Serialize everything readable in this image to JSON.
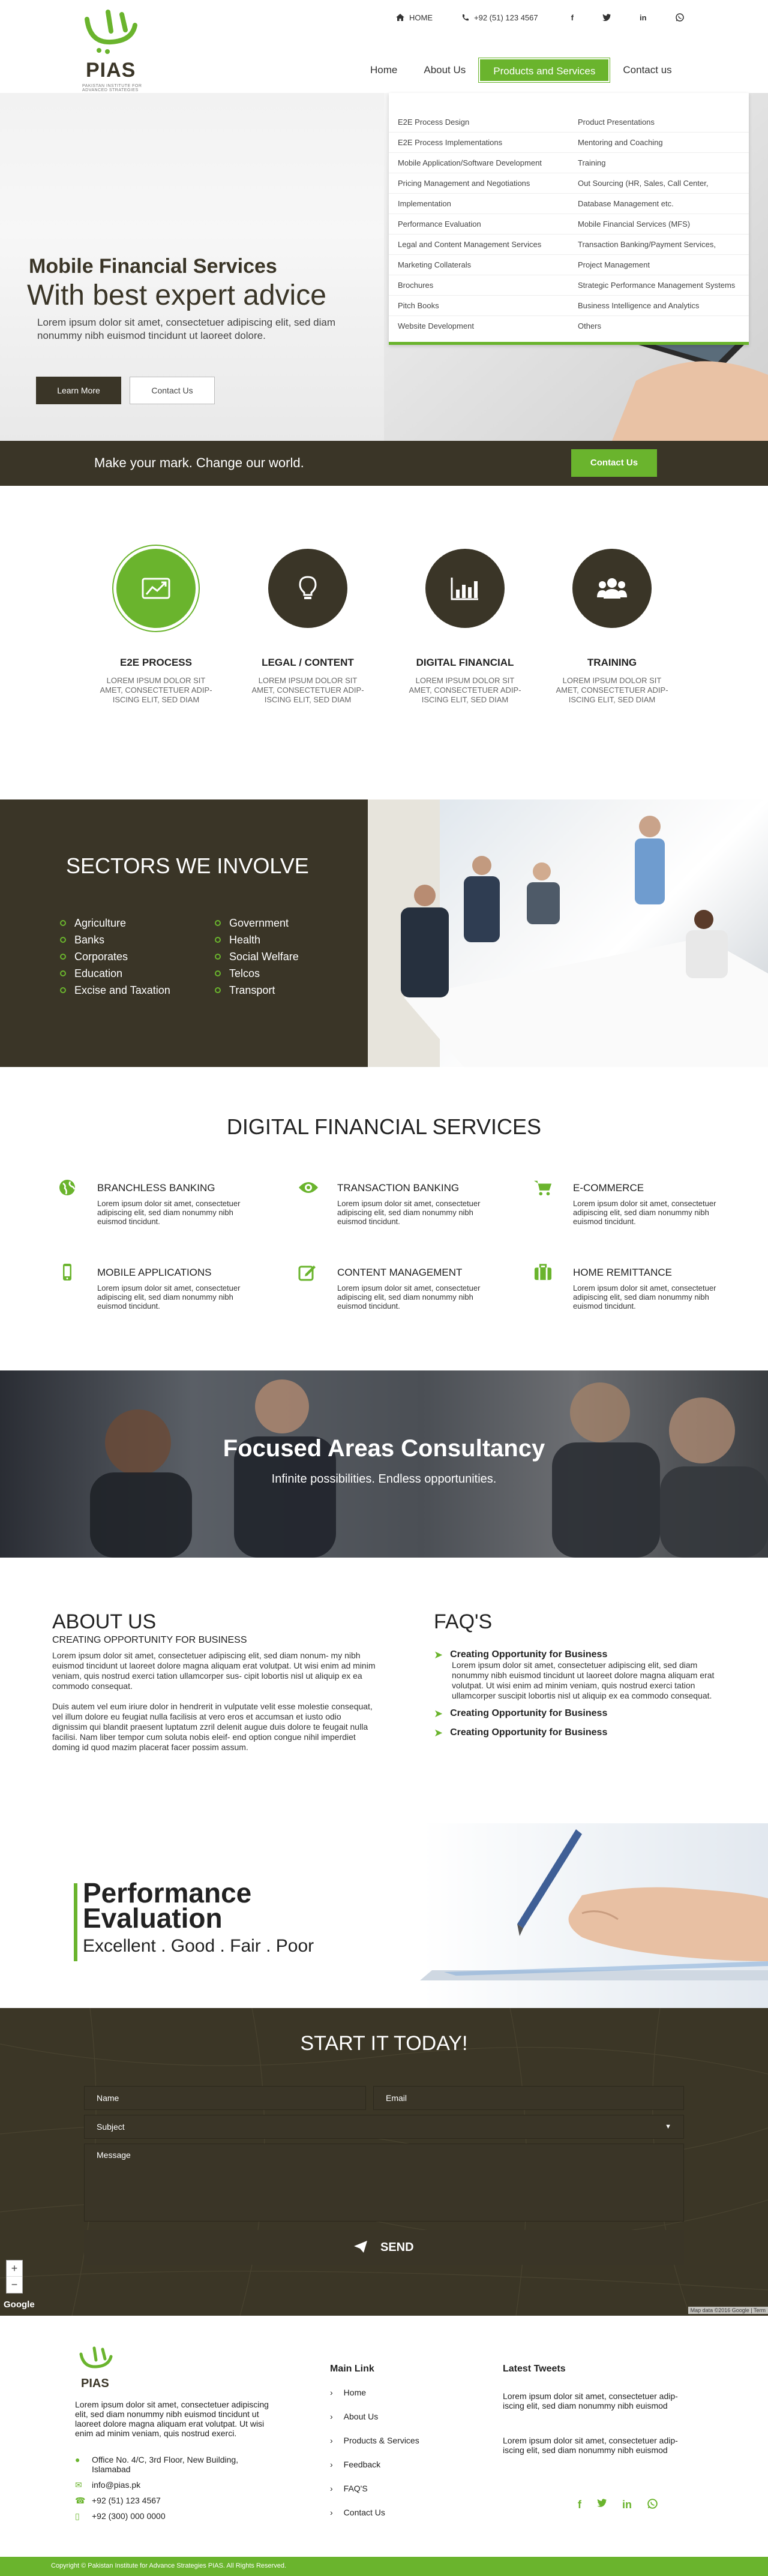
{
  "brand": {
    "name": "PIAS",
    "tagline": "PAKISTAN INSTITUTE FOR ADVANCED STRATEGIES",
    "accent": "#6ab42d",
    "dark": "#3a3527"
  },
  "topbar": {
    "home": "HOME",
    "phone": "+92 (51) 123 4567",
    "social": [
      "facebook-icon",
      "twitter-icon",
      "linkedin-icon",
      "whatsapp-icon"
    ]
  },
  "nav": {
    "items": [
      {
        "label": "Home"
      },
      {
        "label": "About Us"
      },
      {
        "label": "Products and Services"
      },
      {
        "label": "Contact us"
      }
    ]
  },
  "dropdown": {
    "col1": [
      "E2E Process Design",
      "E2E Process Implementations",
      "Mobile Application/Software Development",
      "Pricing Management and Negotiations",
      "Implementation",
      "Performance Evaluation",
      "Legal and Content Management Services",
      "Marketing Collaterals",
      "Brochures",
      "Pitch Books",
      "Website Development"
    ],
    "col2": [
      "Product Presentations",
      "Mentoring and Coaching",
      "Training",
      "Out Sourcing (HR, Sales, Call Center,",
      "Database Management etc.",
      "Mobile Financial Services (MFS)",
      "Transaction Banking/Payment Services,",
      "Project Management",
      "Strategic Performance Management Systems",
      "Business Intelligence and Analytics",
      "Others"
    ]
  },
  "hero": {
    "subtitle": "Mobile Financial Services",
    "title": "With best expert advice",
    "text": "Lorem ipsum dolor sit amet, consectetuer adipiscing elit, sed diam nonummy nibh euismod tincidunt ut laoreet dolore.",
    "btn_primary": "Learn More",
    "btn_secondary": "Contact Us"
  },
  "markbar": {
    "text": "Make your mark. Change our world.",
    "button": "Contact Us"
  },
  "features": [
    {
      "title": "E2E PROCESS",
      "text": "LOREM IPSUM DOLOR SIT AMET, CONSECTETUER ADIP- ISCING ELIT, SED DIAM",
      "icon": "chart-trend-icon"
    },
    {
      "title": "LEGAL / CONTENT",
      "text": "LOREM IPSUM DOLOR SIT AMET, CONSECTETUER ADIP- ISCING ELIT, SED DIAM",
      "icon": "lightbulb-icon"
    },
    {
      "title": "DIGITAL FINANCIAL",
      "text": "LOREM IPSUM DOLOR SIT AMET, CONSECTETUER ADIP- ISCING ELIT, SED DIAM",
      "icon": "bar-chart-icon"
    },
    {
      "title": "TRAINING",
      "text": "LOREM IPSUM DOLOR SIT AMET, CONSECTETUER ADIP- ISCING ELIT, SED DIAM",
      "icon": "users-icon"
    }
  ],
  "sectors": {
    "title": "SECTORS WE INVOLVE",
    "col1": [
      "Agriculture",
      "Banks",
      "Corporates",
      "Education",
      "Excise and Taxation"
    ],
    "col2": [
      "Government",
      "Health",
      "Social Welfare",
      "Telcos",
      "Transport"
    ]
  },
  "dfs": {
    "title": "DIGITAL FINANCIAL SERVICES",
    "items": [
      {
        "title": "BRANCHLESS BANKING",
        "text": "Lorem ipsum dolor sit amet, consectetuer adipiscing elit, sed diam nonummy nibh euismod tincidunt.",
        "icon": "globe-icon"
      },
      {
        "title": "TRANSACTION BANKING",
        "text": "Lorem ipsum dolor sit amet, consectetuer adipiscing elit, sed diam nonummy nibh euismod tincidunt.",
        "icon": "eye-icon"
      },
      {
        "title": "E-COMMERCE",
        "text": "Lorem ipsum dolor sit amet, consectetuer adipiscing elit, sed diam nonummy nibh euismod tincidunt.",
        "icon": "cart-icon"
      },
      {
        "title": "MOBILE APPLICATIONS",
        "text": "Lorem ipsum dolor sit amet, consectetuer adipiscing elit, sed diam nonummy nibh euismod tincidunt.",
        "icon": "mobile-icon"
      },
      {
        "title": "CONTENT MANAGEMENT",
        "text": "Lorem ipsum dolor sit amet, consectetuer adipiscing elit, sed diam nonummy nibh euismod tincidunt.",
        "icon": "edit-icon"
      },
      {
        "title": "HOME REMITTANCE",
        "text": "Lorem ipsum dolor sit amet, consectetuer adipiscing elit, sed diam nonummy nibh euismod tincidunt.",
        "icon": "briefcase-icon"
      }
    ]
  },
  "focused": {
    "title": "Focused Areas Consultancy",
    "subtitle": "Infinite possibilities. Endless opportunities."
  },
  "about": {
    "title": "ABOUT US",
    "subtitle": "CREATING OPPORTUNITY FOR BUSINESS",
    "p1": "Lorem ipsum dolor sit amet, consectetuer adipiscing elit, sed diam nonum- my nibh euismod tincidunt ut laoreet dolore magna aliquam erat volutpat. Ut wisi enim ad minim veniam, quis nostrud exerci tation ullamcorper sus- cipit lobortis nisl ut aliquip ex ea commodo consequat.",
    "p2": "Duis autem vel eum iriure dolor in hendrerit in vulputate velit esse molestie consequat, vel illum dolore eu feugiat nulla facilisis at vero eros et accumsan et iusto odio dignissim qui blandit praesent luptatum zzril delenit augue duis dolore te feugait nulla facilisi. Nam liber tempor cum soluta nobis eleif- end option congue nihil imperdiet doming id quod mazim placerat facer possim assum."
  },
  "faq": {
    "title": "FAQ'S",
    "items": [
      {
        "q": "Creating Opportunity for Business",
        "a": "Lorem ipsum dolor sit amet, consectetuer adipiscing elit, sed diam nonummy nibh euismod tincidunt ut laoreet dolore magna aliquam erat volutpat. Ut wisi enim ad minim veniam, quis nostrud exerci tation ullamcorper suscipit lobortis nisl ut aliquip ex ea commodo consequat."
      },
      {
        "q": "Creating Opportunity for Business",
        "a": ""
      },
      {
        "q": "Creating Opportunity for Business",
        "a": ""
      }
    ]
  },
  "performance": {
    "title1": "Performance",
    "title2": "Evaluation",
    "subtitle": "Excellent . Good . Fair . Poor"
  },
  "start": {
    "title": "START IT TODAY!",
    "name_ph": "Name",
    "email_ph": "Email",
    "subject": "Subject",
    "message_ph": "Message",
    "send": "SEND",
    "google": "Google",
    "map_credit": "Map data ©2016 Google | Term"
  },
  "footer": {
    "about": "Lorem ipsum dolor sit amet, consectetuer adipiscing elit, sed diam nonummy nibh euismod tincidunt ut laoreet dolore magna aliquam erat volutpat. Ut wisi enim ad minim veniam, quis nostrud exerci.",
    "address": "Office No. 4/C, 3rd Floor, New Building, Islamabad",
    "email": "info@pias.pk",
    "phone1": "+92 (51) 123 4567",
    "phone2": "+92 (300) 000 0000",
    "links_title": "Main Link",
    "links": [
      "Home",
      "About Us",
      "Products & Services",
      "Feedback",
      "FAQ'S",
      "Contact Us"
    ],
    "tweets_title": "Latest Tweets",
    "tweet1": "Lorem ipsum dolor sit amet, consectetuer adip- iscing elit, sed diam nonummy nibh euismod",
    "tweet2": "Lorem ipsum dolor sit amet, consectetuer adip- iscing elit, sed diam nonummy nibh euismod",
    "copyright": "Copyright © Pakistan Institute for Advance Strategies PIAS. All Rights Reserved."
  }
}
